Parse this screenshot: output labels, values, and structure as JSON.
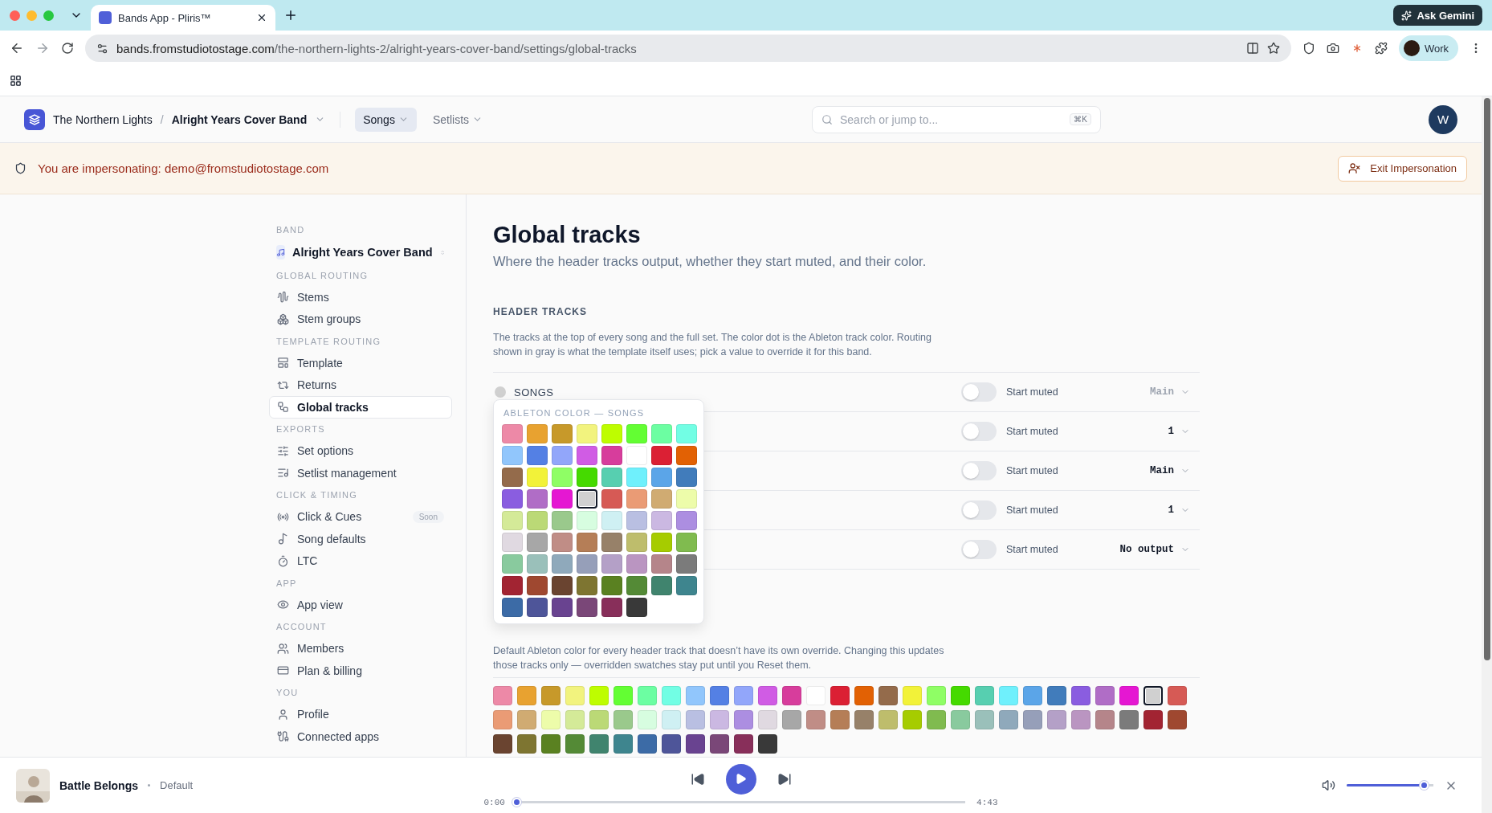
{
  "browser": {
    "tab_title": "Bands App - Pliris™",
    "url_host": "bands.fromstudiotostage.com",
    "url_path": "/the-northern-lights-2/alright-years-cover-band/settings/global-tracks",
    "ask_button": "Ask Gemini",
    "profile": "Work"
  },
  "header": {
    "breadcrumb": [
      "The Northern Lights",
      "Alright Years Cover Band"
    ],
    "separator": "/",
    "nav": [
      {
        "label": "Songs",
        "selected": true
      },
      {
        "label": "Setlists",
        "selected": false
      }
    ],
    "search": {
      "placeholder": "Search or jump to...",
      "shortcut": "⌘K"
    },
    "avatar": "W"
  },
  "banner": {
    "text": "You are impersonating: demo@fromstudiotostage.com",
    "button": "Exit Impersonation"
  },
  "sidebar": {
    "band_label": "BAND",
    "band": "Alright Years Cover Band",
    "sections": [
      {
        "title": "GLOBAL ROUTING",
        "items": [
          {
            "label": "Stems",
            "selected": false
          },
          {
            "label": "Stem groups",
            "selected": false
          }
        ]
      },
      {
        "title": "TEMPLATE ROUTING",
        "items": [
          {
            "label": "Template",
            "selected": false
          },
          {
            "label": "Returns",
            "selected": false
          },
          {
            "label": "Global tracks",
            "selected": true
          }
        ]
      },
      {
        "title": "EXPORTS",
        "items": [
          {
            "label": "Set options",
            "selected": false
          },
          {
            "label": "Setlist management",
            "selected": false
          }
        ]
      },
      {
        "title": "CLICK & TIMING",
        "items": [
          {
            "label": "Click & Cues",
            "selected": false,
            "badge": "Soon"
          },
          {
            "label": "Song defaults",
            "selected": false
          },
          {
            "label": "LTC",
            "selected": false
          }
        ]
      },
      {
        "title": "APP",
        "items": [
          {
            "label": "App view",
            "selected": false
          }
        ]
      },
      {
        "title": "ACCOUNT",
        "items": [
          {
            "label": "Members",
            "selected": false
          },
          {
            "label": "Plan & billing",
            "selected": false
          }
        ]
      },
      {
        "title": "YOU",
        "items": [
          {
            "label": "Profile",
            "selected": false
          },
          {
            "label": "Connected apps",
            "selected": false
          }
        ]
      }
    ]
  },
  "page": {
    "title": "Global tracks",
    "subtitle": "Where the header tracks output, whether they start muted, and their color.",
    "section_title": "HEADER TRACKS",
    "section_text": "The tracks at the top of every song and the full set. The color dot is the Ableton track color. Routing shown in gray is what the template itself uses; pick a value to override it for this band.",
    "tracks": [
      {
        "name": "SONGS",
        "color": "#d0d0d0",
        "muted_label": "Start muted",
        "muted": false,
        "output": "Main",
        "inherited": true
      },
      {
        "muted_label": "Start muted",
        "muted": false,
        "output": "1",
        "inherited": false
      },
      {
        "muted_label": "Start muted",
        "muted": false,
        "output": "Main",
        "inherited": false
      },
      {
        "muted_label": "Start muted",
        "muted": false,
        "output": "1",
        "inherited": false
      },
      {
        "muted_label": "Start muted",
        "muted": false,
        "output": "No output",
        "inherited": false
      }
    ],
    "popover": {
      "title": "ABLETON COLOR — SONGS",
      "swatches": [
        {
          "color": "#ed89a7",
          "selected": false
        },
        {
          "color": "#e8a230",
          "selected": false
        },
        {
          "color": "#c7992a",
          "selected": false
        },
        {
          "color": "#f2f37e",
          "selected": false
        },
        {
          "color": "#befd00",
          "selected": false
        },
        {
          "color": "#63fe33",
          "selected": false
        },
        {
          "color": "#6cfea2",
          "selected": false
        },
        {
          "color": "#72fee4",
          "selected": false
        },
        {
          "color": "#91c6fc",
          "selected": false
        },
        {
          "color": "#5480e4",
          "selected": false
        },
        {
          "color": "#92a6fa",
          "selected": false
        },
        {
          "color": "#d05ce4",
          "selected": false
        },
        {
          "color": "#d73d9c",
          "selected": false
        },
        {
          "color": "#ffffff",
          "selected": false
        },
        {
          "color": "#db2034",
          "selected": false
        },
        {
          "color": "#e26104",
          "selected": false
        },
        {
          "color": "#946b4b",
          "selected": false
        },
        {
          "color": "#f2f239",
          "selected": false
        },
        {
          "color": "#8ffe65",
          "selected": false
        },
        {
          "color": "#45da00",
          "selected": false
        },
        {
          "color": "#57cfb0",
          "selected": false
        },
        {
          "color": "#6ff0fc",
          "selected": false
        },
        {
          "color": "#5ba5e8",
          "selected": false
        },
        {
          "color": "#417cbb",
          "selected": false
        },
        {
          "color": "#8a5de0",
          "selected": false
        },
        {
          "color": "#b06dc6",
          "selected": false
        },
        {
          "color": "#e517d2",
          "selected": false
        },
        {
          "color": "#d0d0d0",
          "selected": true
        },
        {
          "color": "#d65a55",
          "selected": false
        },
        {
          "color": "#ea9b75",
          "selected": false
        },
        {
          "color": "#d0ab72",
          "selected": false
        },
        {
          "color": "#edfcaa",
          "selected": false
        },
        {
          "color": "#d4ea98",
          "selected": false
        },
        {
          "color": "#bbd976",
          "selected": false
        },
        {
          "color": "#9ac98c",
          "selected": false
        },
        {
          "color": "#d7fde0",
          "selected": false
        },
        {
          "color": "#cff0f3",
          "selected": false
        },
        {
          "color": "#b9bfe2",
          "selected": false
        },
        {
          "color": "#cbb8e2",
          "selected": false
        },
        {
          "color": "#ac8ee1",
          "selected": false
        },
        {
          "color": "#e0d9e1",
          "selected": false
        },
        {
          "color": "#a7a7a7",
          "selected": false
        },
        {
          "color": "#c08d86",
          "selected": false
        },
        {
          "color": "#b57e57",
          "selected": false
        },
        {
          "color": "#978169",
          "selected": false
        },
        {
          "color": "#bebd6c",
          "selected": false
        },
        {
          "color": "#a6cc00",
          "selected": false
        },
        {
          "color": "#80bb4f",
          "selected": false
        },
        {
          "color": "#89ca9e",
          "selected": false
        },
        {
          "color": "#9ac0ba",
          "selected": false
        },
        {
          "color": "#8fa9bb",
          "selected": false
        },
        {
          "color": "#969fb9",
          "selected": false
        },
        {
          "color": "#b4a0c7",
          "selected": false
        },
        {
          "color": "#ba95c1",
          "selected": false
        },
        {
          "color": "#b5858a",
          "selected": false
        },
        {
          "color": "#7b7b7b",
          "selected": false
        },
        {
          "color": "#a22432",
          "selected": false
        },
        {
          "color": "#9f4830",
          "selected": false
        },
        {
          "color": "#6a4430",
          "selected": false
        },
        {
          "color": "#7e7531",
          "selected": false
        },
        {
          "color": "#5a8121",
          "selected": false
        },
        {
          "color": "#548a36",
          "selected": false
        },
        {
          "color": "#40846e",
          "selected": false
        },
        {
          "color": "#3e858e",
          "selected": false
        },
        {
          "color": "#3c6ba6",
          "selected": false
        },
        {
          "color": "#4e5599",
          "selected": false
        },
        {
          "color": "#694390",
          "selected": false
        },
        {
          "color": "#7a4778",
          "selected": false
        },
        {
          "color": "#882f5a",
          "selected": false
        },
        {
          "color": "#393939",
          "selected": false
        }
      ]
    },
    "default_text": "Default Ableton color for every header track that doesn’t have its own override. Changing this updates those tracks only — overridden swatches stay put until you Reset them.",
    "default_swatches": [
      {
        "color": "#ed89a7",
        "selected": false
      },
      {
        "color": "#e8a230",
        "selected": false
      },
      {
        "color": "#c7992a",
        "selected": false
      },
      {
        "color": "#f2f37e",
        "selected": false
      },
      {
        "color": "#befd00",
        "selected": false
      },
      {
        "color": "#63fe33",
        "selected": false
      },
      {
        "color": "#6cfea2",
        "selected": false
      },
      {
        "color": "#72fee4",
        "selected": false
      },
      {
        "color": "#91c6fc",
        "selected": false
      },
      {
        "color": "#5480e4",
        "selected": false
      },
      {
        "color": "#92a6fa",
        "selected": false
      },
      {
        "color": "#d05ce4",
        "selected": false
      },
      {
        "color": "#d73d9c",
        "selected": false
      },
      {
        "color": "#ffffff",
        "selected": false
      },
      {
        "color": "#db2034",
        "selected": false
      },
      {
        "color": "#e26104",
        "selected": false
      },
      {
        "color": "#946b4b",
        "selected": false
      },
      {
        "color": "#f2f239",
        "selected": false
      },
      {
        "color": "#8ffe65",
        "selected": false
      },
      {
        "color": "#45da00",
        "selected": false
      },
      {
        "color": "#57cfb0",
        "selected": false
      },
      {
        "color": "#6ff0fc",
        "selected": false
      },
      {
        "color": "#5ba5e8",
        "selected": false
      },
      {
        "color": "#417cbb",
        "selected": false
      },
      {
        "color": "#8a5de0",
        "selected": false
      },
      {
        "color": "#b06dc6",
        "selected": false
      },
      {
        "color": "#e517d2",
        "selected": false
      },
      {
        "color": "#d0d0d0",
        "selected": true
      },
      {
        "color": "#d65a55",
        "selected": false
      },
      {
        "color": "#ea9b75",
        "selected": false
      },
      {
        "color": "#d0ab72",
        "selected": false
      },
      {
        "color": "#edfcaa",
        "selected": false
      },
      {
        "color": "#d4ea98",
        "selected": false
      },
      {
        "color": "#bbd976",
        "selected": false
      },
      {
        "color": "#9ac98c",
        "selected": false
      },
      {
        "color": "#d7fde0",
        "selected": false
      },
      {
        "color": "#cff0f3",
        "selected": false
      },
      {
        "color": "#b9bfe2",
        "selected": false
      },
      {
        "color": "#cbb8e2",
        "selected": false
      },
      {
        "color": "#ac8ee1",
        "selected": false
      },
      {
        "color": "#e0d9e1",
        "selected": false
      },
      {
        "color": "#a7a7a7",
        "selected": false
      },
      {
        "color": "#c08d86",
        "selected": false
      },
      {
        "color": "#b57e57",
        "selected": false
      },
      {
        "color": "#978169",
        "selected": false
      },
      {
        "color": "#bebd6c",
        "selected": false
      },
      {
        "color": "#a6cc00",
        "selected": false
      },
      {
        "color": "#80bb4f",
        "selected": false
      },
      {
        "color": "#89ca9e",
        "selected": false
      },
      {
        "color": "#9ac0ba",
        "selected": false
      },
      {
        "color": "#8fa9bb",
        "selected": false
      },
      {
        "color": "#969fb9",
        "selected": false
      },
      {
        "color": "#b4a0c7",
        "selected": false
      },
      {
        "color": "#ba95c1",
        "selected": false
      },
      {
        "color": "#b5858a",
        "selected": false
      },
      {
        "color": "#7b7b7b",
        "selected": false
      },
      {
        "color": "#a22432",
        "selected": false
      },
      {
        "color": "#9f4830",
        "selected": false
      },
      {
        "color": "#6a4430",
        "selected": false
      },
      {
        "color": "#7e7531",
        "selected": false
      },
      {
        "color": "#5a8121",
        "selected": false
      },
      {
        "color": "#548a36",
        "selected": false
      },
      {
        "color": "#40846e",
        "selected": false
      },
      {
        "color": "#3e858e",
        "selected": false
      },
      {
        "color": "#3c6ba6",
        "selected": false
      },
      {
        "color": "#4e5599",
        "selected": false
      },
      {
        "color": "#694390",
        "selected": false
      },
      {
        "color": "#7a4778",
        "selected": false
      },
      {
        "color": "#882f5a",
        "selected": false
      },
      {
        "color": "#393939",
        "selected": false
      }
    ]
  },
  "player": {
    "title": "Battle Belongs",
    "subtitle": "Default",
    "elapsed": "0:00",
    "duration": "4:43",
    "level": 0.0,
    "volume": {
      "level": 0.89
    }
  }
}
